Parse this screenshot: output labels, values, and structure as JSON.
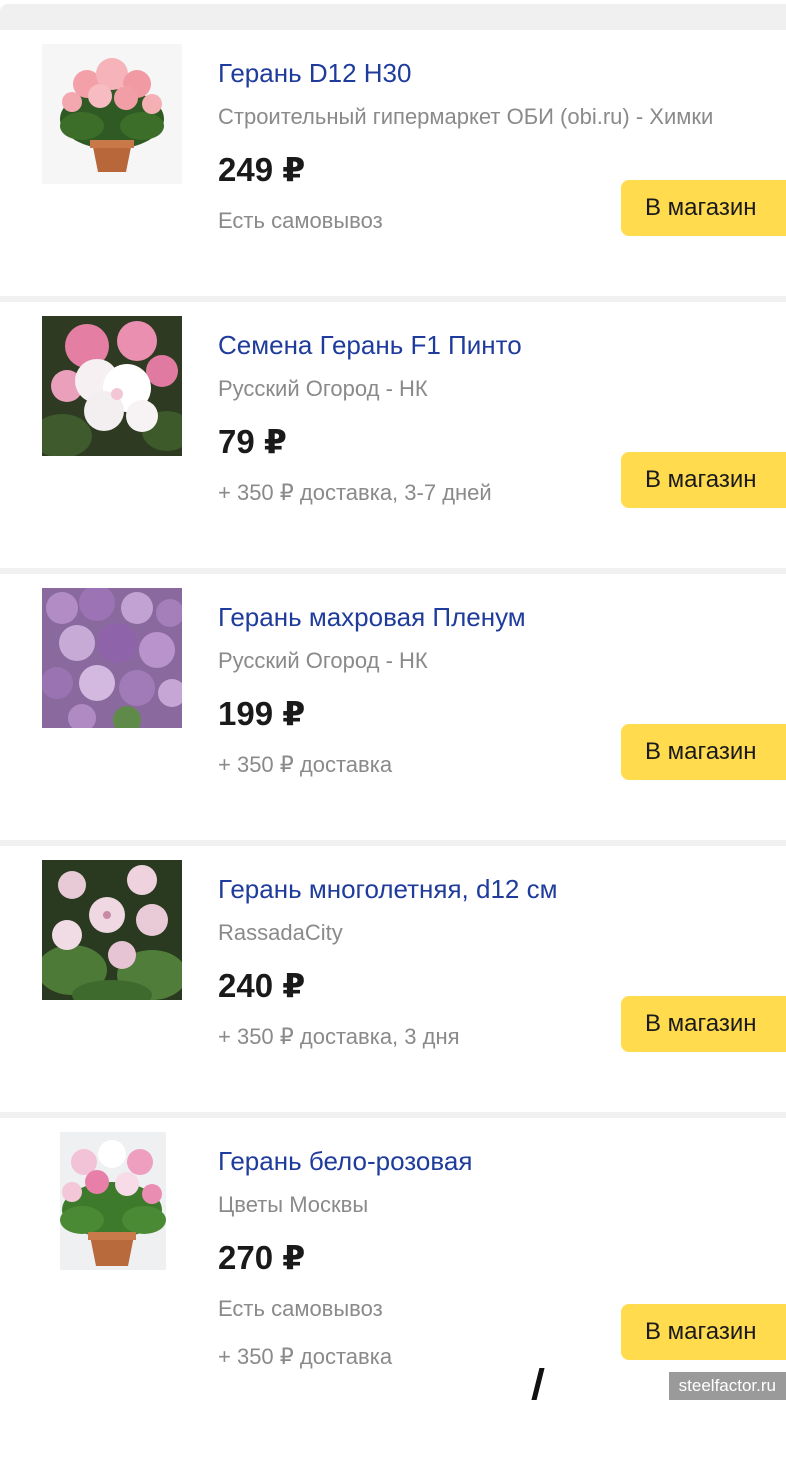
{
  "offers": [
    {
      "title": "Герань D12 H30",
      "shop": "Строительный гипермаркет ОБИ (obi.ru) - Химки",
      "price": "249 ₽",
      "delivery": "Есть самовывоз",
      "delivery_extra": "",
      "button": "В магазин",
      "image": "potted-pink-geranium"
    },
    {
      "title": "Семена Герань F1 Пинто",
      "shop": "Русский Огород - НК",
      "price": "79 ₽",
      "delivery": "+ 350 ₽ доставка, 3-7 дней",
      "delivery_extra": "",
      "button": "В магазин",
      "image": "white-pink-geranium-closeup"
    },
    {
      "title": "Герань махровая Пленум",
      "shop": "Русский Огород - НК",
      "price": "199 ₽",
      "delivery": "+ 350 ₽ доставка",
      "delivery_extra": "",
      "button": "В магазин",
      "image": "purple-double-geranium"
    },
    {
      "title": "Герань многолетняя, d12 см",
      "shop": "RassadaCity",
      "price": "240 ₽",
      "delivery": "+ 350 ₽ доставка, 3 дня",
      "delivery_extra": "",
      "button": "В магазин",
      "image": "pale-pink-perennial-geranium"
    },
    {
      "title": "Герань бело-розовая",
      "shop": "Цветы Москвы",
      "price": "270 ₽",
      "delivery": "Есть самовывоз",
      "delivery_extra": "+ 350 ₽ доставка",
      "button": "В магазин",
      "image": "white-pink-potted-geranium"
    }
  ],
  "watermark": "steelfactor.ru",
  "colors": {
    "link": "#1f3c9c",
    "button": "#ffdb4d",
    "muted": "#8a8a8a",
    "divider": "#f1f1f1"
  }
}
